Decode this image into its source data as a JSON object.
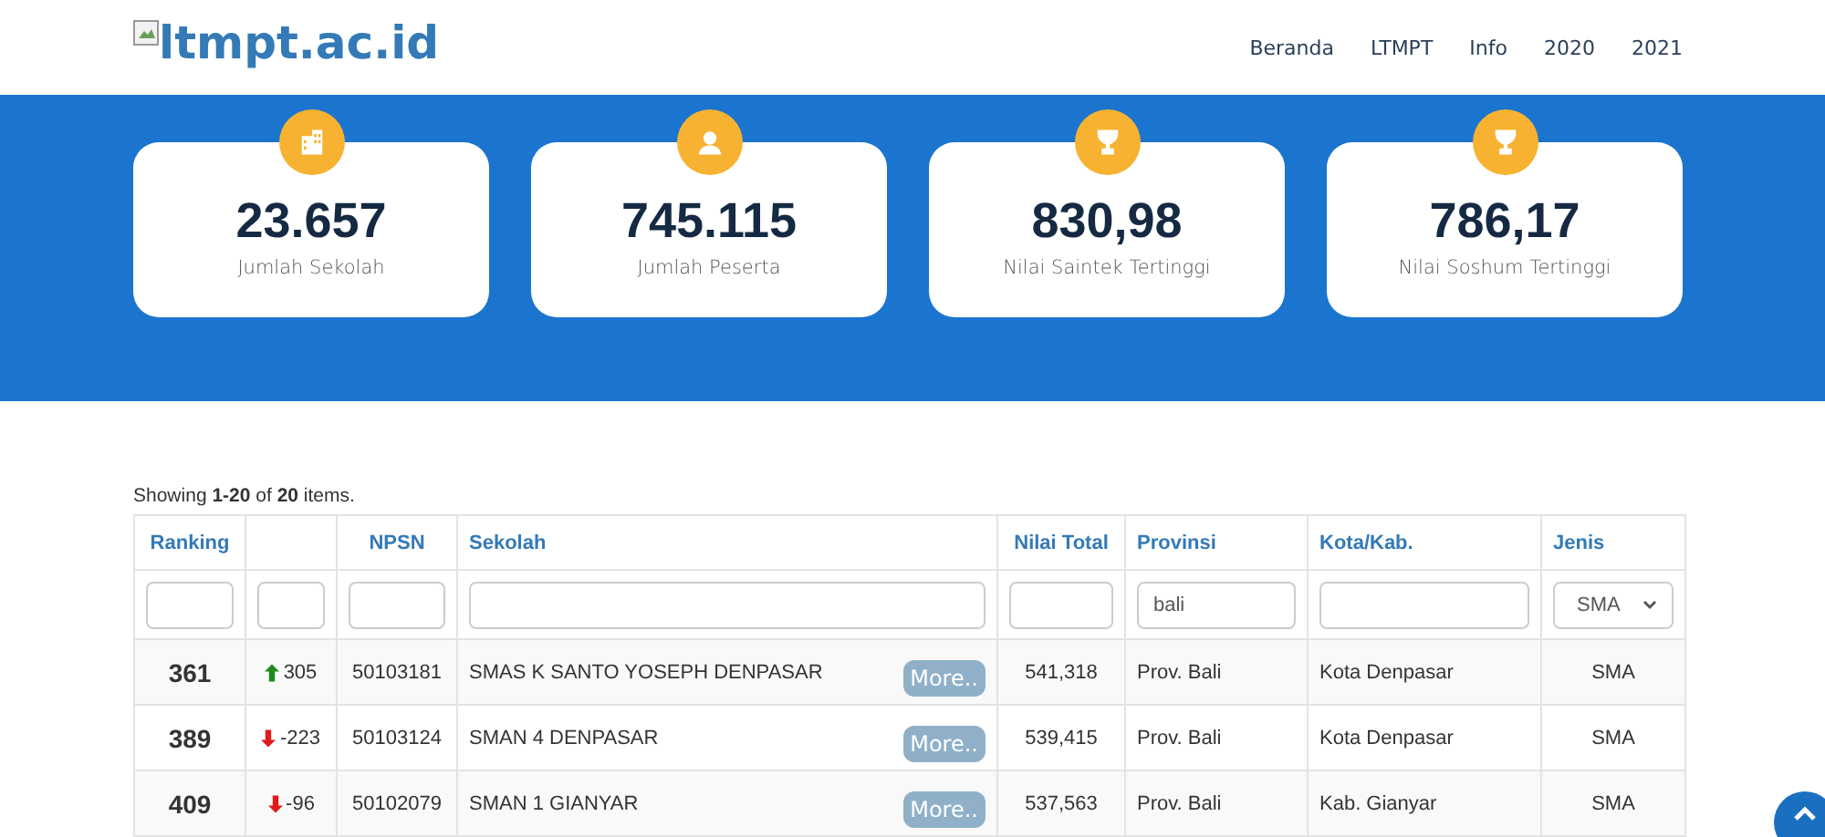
{
  "header": {
    "logo": "ltmpt.ac.id",
    "nav": [
      "Beranda",
      "LTMPT",
      "Info",
      "2020",
      "2021"
    ]
  },
  "stats": [
    {
      "kind": "building",
      "value": "23.657",
      "label": "Jumlah Sekolah"
    },
    {
      "kind": "person",
      "value": "745.115",
      "label": "Jumlah Peserta"
    },
    {
      "kind": "trophy",
      "value": "830,98",
      "label": "Nilai Saintek Tertinggi"
    },
    {
      "kind": "trophy",
      "value": "786,17",
      "label": "Nilai Soshum Tertinggi"
    }
  ],
  "summary": "Showing **1-20** of **20** items.",
  "table": {
    "columns": [
      "Ranking",
      "",
      "NPSN",
      "Sekolah",
      "Nilai Total",
      "Provinsi",
      "Kota/Kab.",
      "Jenis"
    ],
    "filters": [
      {
        "kind": "text"
      },
      {
        "kind": "text"
      },
      {
        "kind": "text"
      },
      {
        "kind": "text"
      },
      {
        "kind": "text"
      },
      {
        "kind": "text",
        "value": "bali"
      },
      {
        "kind": "text"
      },
      {
        "kind": "select",
        "value": "SMA"
      }
    ],
    "rows": [
      {
        "ranking": "361",
        "kind": "up",
        "change": "305",
        "npsn": "50103181",
        "sekolah": "SMAS K SANTO YOSEPH DENPASAR",
        "more": "More..",
        "nilai": "541,318",
        "provinsi": "Prov. Bali",
        "kota": "Kota Denpasar",
        "jenis": "SMA"
      },
      {
        "ranking": "389",
        "kind": "down",
        "change": "-223",
        "npsn": "50103124",
        "sekolah": "SMAN 4 DENPASAR",
        "more": "More..",
        "nilai": "539,415",
        "provinsi": "Prov. Bali",
        "kota": "Kota Denpasar",
        "jenis": "SMA"
      },
      {
        "ranking": "409",
        "kind": "down",
        "change": "-96",
        "npsn": "50102079",
        "sekolah": "SMAN 1 GIANYAR",
        "more": "More..",
        "nilai": "537,563",
        "provinsi": "Prov. Bali",
        "kota": "Kab. Gianyar",
        "jenis": "SMA"
      }
    ]
  }
}
